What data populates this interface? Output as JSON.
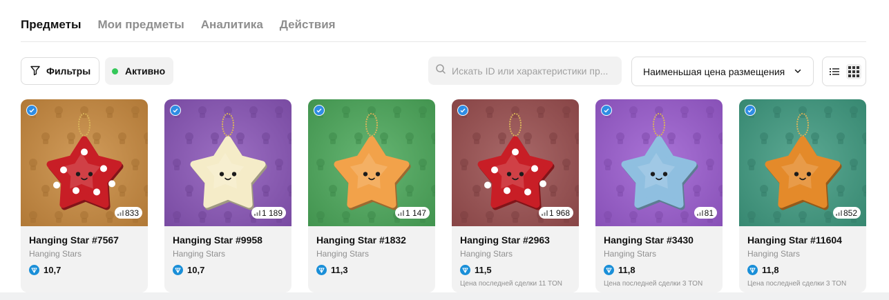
{
  "tabs": [
    {
      "label": "Предметы",
      "active": true
    },
    {
      "label": "Мои предметы",
      "active": false
    },
    {
      "label": "Аналитика",
      "active": false
    },
    {
      "label": "Действия",
      "active": false
    }
  ],
  "toolbar": {
    "filters_label": "Фильтры",
    "status_label": "Активно",
    "status_color": "#34c759",
    "search_placeholder": "Искать ID или характеристики пр...",
    "sort_label": "Наименьшая цена размещения",
    "view_modes": [
      "list-icon",
      "grid-icon"
    ],
    "view_selected": "grid"
  },
  "items": [
    {
      "title": "Hanging Star #7567",
      "collection": "Hanging Stars",
      "price": "10,7",
      "supply": "833",
      "last_sale": "",
      "bg": "#c98a3e",
      "star": "#c81e26",
      "pattern": "gingerbread"
    },
    {
      "title": "Hanging Star #9958",
      "collection": "Hanging Stars",
      "price": "10,7",
      "supply": "1 189",
      "last_sale": "",
      "bg": "#8a55b8",
      "star": "#f5ecc8",
      "pattern": "mug"
    },
    {
      "title": "Hanging Star #1832",
      "collection": "Hanging Stars",
      "price": "11,3",
      "supply": "1 147",
      "last_sale": "",
      "bg": "#4ba85a",
      "star": "#f2a24a",
      "pattern": "bell"
    },
    {
      "title": "Hanging Star #2963",
      "collection": "Hanging Stars",
      "price": "11,5",
      "supply": "1 968",
      "last_sale": "Цена последней сделки 11 TON",
      "bg": "#9a4e4f",
      "star": "#c81e26",
      "pattern": "mitten"
    },
    {
      "title": "Hanging Star #3430",
      "collection": "Hanging Stars",
      "price": "11,8",
      "supply": "81",
      "last_sale": "Цена последней сделки 3 TON",
      "bg": "#9b5cd0",
      "star": "#8fbfe0",
      "pattern": "leaf"
    },
    {
      "title": "Hanging Star #11604",
      "collection": "Hanging Stars",
      "price": "11,8",
      "supply": "852",
      "last_sale": "Цена последней сделки 3 TON",
      "bg": "#3f9a80",
      "star": "#e48a2a",
      "pattern": "cupcake"
    }
  ]
}
